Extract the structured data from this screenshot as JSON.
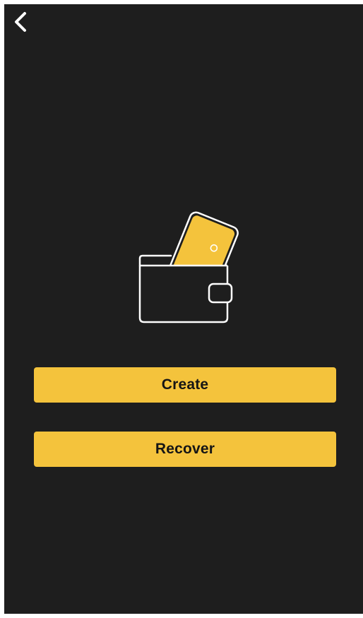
{
  "icons": {
    "back": "chevron-left-icon",
    "illustration": "wallet-with-card-icon"
  },
  "colors": {
    "background": "#1e1e1e",
    "accent": "#f4c33c",
    "button_text": "#151515",
    "icon_stroke": "#ffffff"
  },
  "actions": {
    "create_label": "Create",
    "recover_label": "Recover"
  }
}
